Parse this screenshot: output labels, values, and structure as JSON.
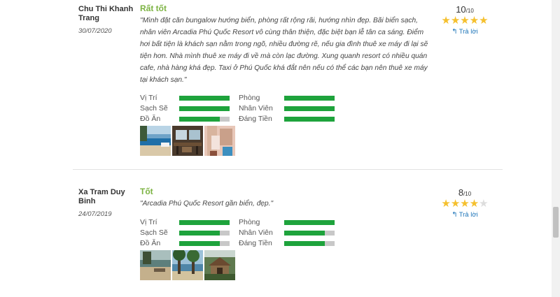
{
  "reviews": [
    {
      "author": "Chu Thi Khanh Trang",
      "date": "30/07/2020",
      "verdict": "Rất tốt",
      "comment": "\"Mình đặt căn bungalow hướng biển, phòng rất rộng rãi, hướng nhìn đẹp. Bãi biển sạch, nhân viên Arcadia Phú Quốc Resort vô cùng thân thiện, đặc biệt bạn lễ tân ca sáng. Điểm hơi bất tiện là khách sạn nằm trong ngõ, nhiều đường rẽ, nếu gia đình thuê xe máy đi lại sẽ tiện hơn. Nhà mình thuê xe máy đi về mà còn lạc đường. Xung quanh resort có nhiều quán cafe, nhà hàng khá đẹp. Taxi ở Phú Quốc khá đắt nên nếu có thể các bạn nên thuê xe máy tại khách sạn.\"",
      "score": "10",
      "score_max": "/10",
      "stars_filled": 5,
      "reply_label": "Trả lời",
      "ratings": [
        {
          "label": "Vị Trí",
          "value": 1.0
        },
        {
          "label": "Sạch Sẽ",
          "value": 1.0
        },
        {
          "label": "Đồ Ăn",
          "value": 0.8
        },
        {
          "label": "Phòng",
          "value": 1.0
        },
        {
          "label": "Nhân Viên",
          "value": 1.0
        },
        {
          "label": "Đáng Tiền",
          "value": 1.0
        }
      ]
    },
    {
      "author": "Xa Tram Duy Binh",
      "date": "24/07/2019",
      "verdict": "Tốt",
      "comment": "\"Arcadia Phú Quốc Resort gần biển, đẹp.\"",
      "score": "8",
      "score_max": "/10",
      "stars_filled": 4,
      "reply_label": "Trả lời",
      "ratings": [
        {
          "label": "Vị Trí",
          "value": 1.0
        },
        {
          "label": "Sạch Sẽ",
          "value": 0.8
        },
        {
          "label": "Đồ Ăn",
          "value": 0.8
        },
        {
          "label": "Phòng",
          "value": 1.0
        },
        {
          "label": "Nhân Viên",
          "value": 0.8
        },
        {
          "label": "Đáng Tiền",
          "value": 0.8
        }
      ]
    }
  ],
  "colors": {
    "verdict_green": "#7cb342",
    "bar_fill": "#1ea33c",
    "bar_track": "#c8c8c8",
    "star_on": "#f5c02e",
    "star_off": "#dddddd",
    "reply_blue": "#1a73b8"
  },
  "icons": {
    "reply": "reply-arrow-icon",
    "star": "star-icon"
  }
}
